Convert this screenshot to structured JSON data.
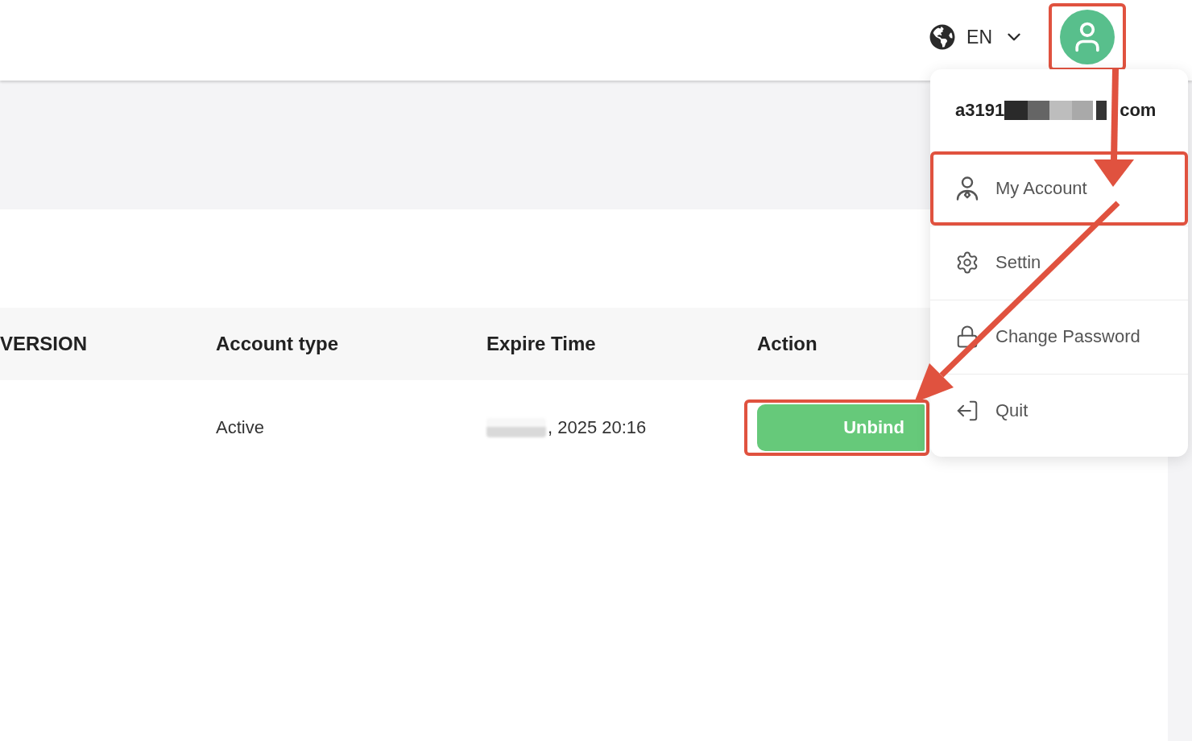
{
  "header": {
    "language": "EN",
    "account": {
      "highlighted": true
    }
  },
  "table": {
    "columns": [
      "VERSION",
      "Account type",
      "Expire Time",
      "Action"
    ],
    "rows": [
      {
        "account_type": "Active",
        "expire_time": ", 2025 20:16",
        "expire_time_redacted": true,
        "action": "Unbind",
        "highlighted": true
      }
    ]
  },
  "account_menu": {
    "open": true,
    "email": {
      "start": "a3191",
      "end": "com",
      "redacted": true
    },
    "items": [
      {
        "label": "My Account",
        "kind": "account",
        "highlighted": true
      },
      {
        "label": "Settin",
        "kind": "settings",
        "highlighted": false
      },
      {
        "label": "Change Password",
        "kind": "password",
        "highlighted": false
      },
      {
        "label": "Quit",
        "kind": "quit",
        "highlighted": false
      }
    ]
  }
}
